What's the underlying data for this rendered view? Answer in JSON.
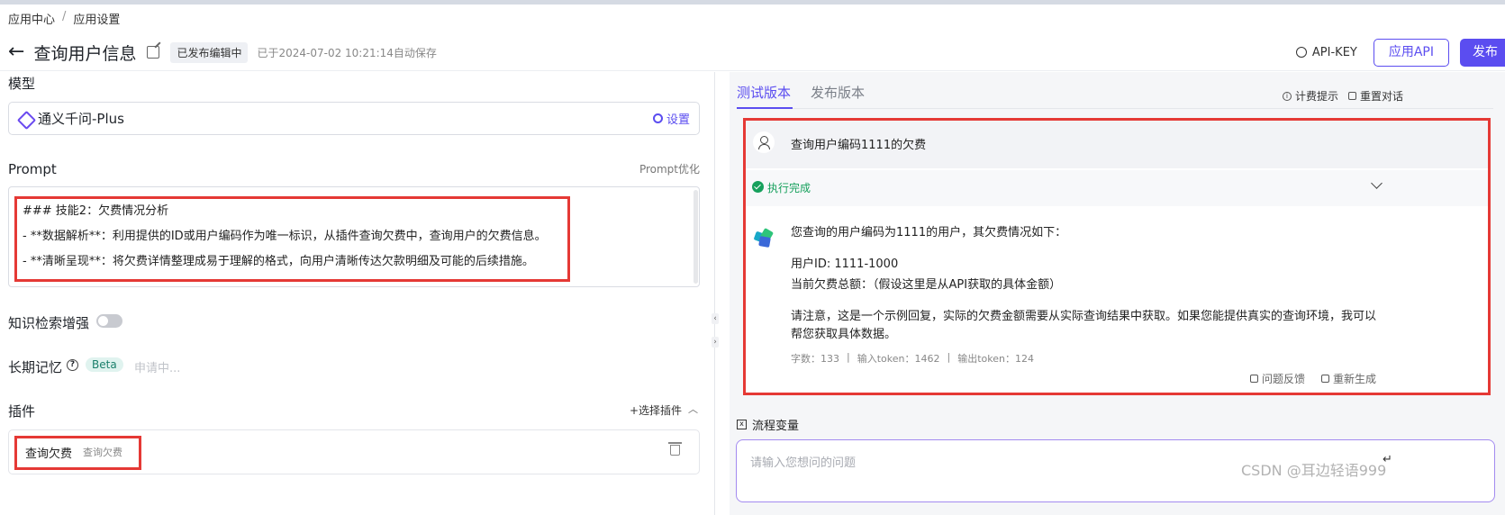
{
  "breadcrumb": {
    "root": "应用中心",
    "separator": "/",
    "current": "应用设置"
  },
  "header": {
    "back": "←",
    "title": "查询用户信息",
    "status_badge": "已发布编辑中",
    "autosave": "已于2024-07-02 10:21:14自动保存",
    "api_key_label": "API-KEY",
    "app_api_label": "应用API",
    "publish_label": "发布"
  },
  "model": {
    "section_label": "模型",
    "name": "通义千问-Plus",
    "settings_label": "设置"
  },
  "prompt": {
    "section_label": "Prompt",
    "optimize_label": "Prompt优化",
    "lines": [
      "### 技能2：欠费情况分析",
      "- **数据解析**：利用提供的ID或用户编码作为唯一标识，从插件查询欠费中，查询用户的欠费信息。",
      "- **清晰呈现**：将欠费详情整理成易于理解的格式，向用户清晰传达欠款明细及可能的后续措施。"
    ]
  },
  "knowledge": {
    "label": "知识检索增强",
    "enabled": false
  },
  "memory": {
    "label": "长期记忆",
    "beta": "Beta",
    "status": "申请中..."
  },
  "plugins": {
    "section_label": "插件",
    "add_label": "+选择插件",
    "items": [
      {
        "name": "查询欠费",
        "desc": "查询欠费"
      }
    ]
  },
  "right": {
    "tabs": [
      {
        "label": "测试版本",
        "active": true
      },
      {
        "label": "发布版本",
        "active": false
      }
    ],
    "billing_label": "计费提示",
    "reset_label": "重置对话",
    "user_message": "查询用户编码1111的欠费",
    "exec_status": "执行完成",
    "bot_lines": {
      "intro": "您查询的用户编码为1111的用户，其欠费情况如下：",
      "user_id": "用户ID: 1111-1000",
      "amount": "当前欠费总额：（假设这里是从API获取的具体金额）",
      "note1": "请注意，这是一个示例回复，实际的欠费金额需要从实际查询结果中获取。如果您能提供真实的查询环境，我可以",
      "note2": "帮您获取具体数据。"
    },
    "stats": {
      "words": "字数：133",
      "sep": "|",
      "input_tokens": "输入token：1462",
      "output_tokens": "输出token：124"
    },
    "feedback_label": "问题反馈",
    "regenerate_label": "重新生成",
    "flow_var_label": "流程变量",
    "input_placeholder": "请输入您想问的问题",
    "watermark": "CSDN @耳边轻语999"
  },
  "colors": {
    "accent": "#5b4df0",
    "highlight": "#e53935",
    "success": "#16a05c"
  }
}
